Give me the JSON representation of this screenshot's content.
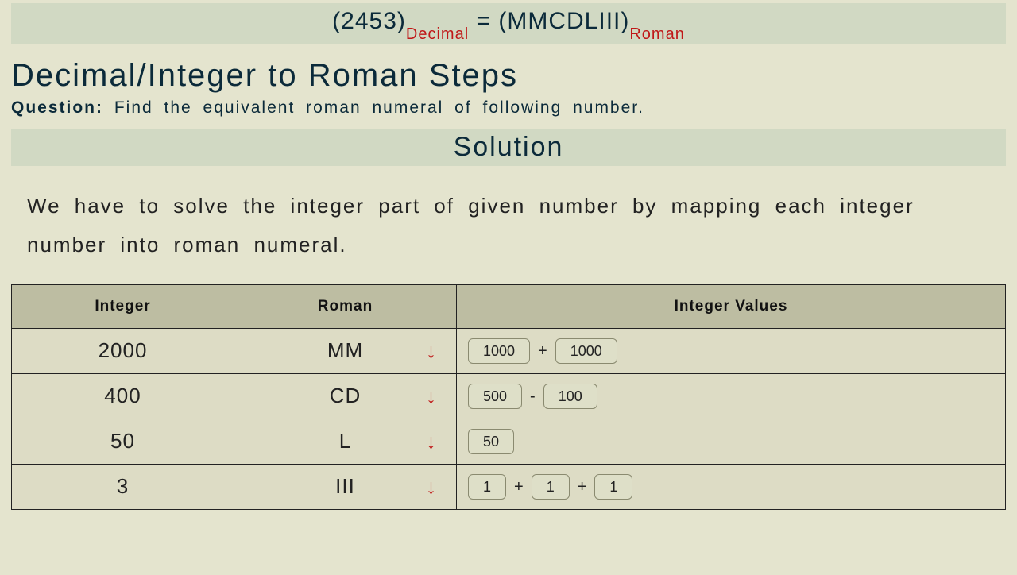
{
  "banner": {
    "left_paren": "(",
    "decimal_value": "2453",
    "right_paren": ")",
    "decimal_label": "Decimal",
    "equals": " = ",
    "roman_value": "MMCDLIII",
    "roman_label": "Roman"
  },
  "title": "Decimal/Integer to Roman Steps",
  "question_label": "Question:",
  "question_text": " Find the equivalent roman numeral of following number.",
  "solution_header": "Solution",
  "explain": "We have to solve the integer part of given number by mapping each integer number into roman numeral.",
  "table": {
    "headers": {
      "integer": "Integer",
      "roman": "Roman",
      "values": "Integer Values"
    },
    "rows": [
      {
        "integer": "2000",
        "roman": "MM",
        "values": [
          "1000",
          "+",
          "1000"
        ]
      },
      {
        "integer": "400",
        "roman": "CD",
        "values": [
          "500",
          "-",
          "100"
        ]
      },
      {
        "integer": "50",
        "roman": "L",
        "values": [
          "50"
        ]
      },
      {
        "integer": "3",
        "roman": "III",
        "values": [
          "1",
          "+",
          "1",
          "+",
          "1"
        ]
      }
    ]
  },
  "arrow_glyph": "↓"
}
